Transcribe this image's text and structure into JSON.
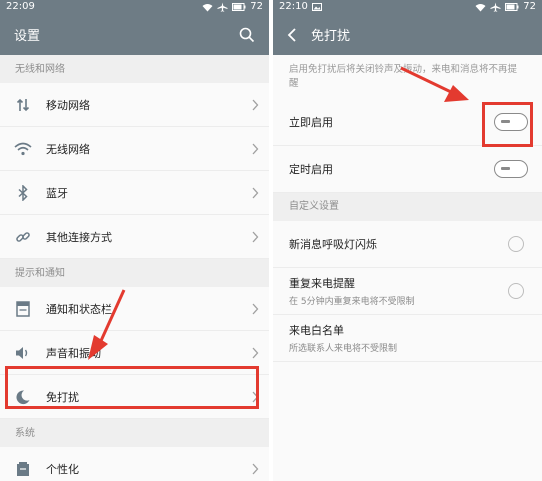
{
  "left_screen": {
    "status_bar": {
      "time": "22:09",
      "battery": "72"
    },
    "header": {
      "title": "设置"
    },
    "sections": [
      {
        "title": "无线和网络",
        "items": [
          {
            "label": "移动网络",
            "icon": "mobile-data-icon"
          },
          {
            "label": "无线网络",
            "icon": "wifi-icon"
          },
          {
            "label": "蓝牙",
            "icon": "bluetooth-icon"
          },
          {
            "label": "其他连接方式",
            "icon": "link-icon"
          }
        ]
      },
      {
        "title": "提示和通知",
        "items": [
          {
            "label": "通知和状态栏",
            "icon": "notification-icon"
          },
          {
            "label": "声音和振动",
            "icon": "sound-icon"
          },
          {
            "label": "免打扰",
            "icon": "moon-icon",
            "highlighted": true
          }
        ]
      },
      {
        "title": "系统",
        "items": [
          {
            "label": "个性化",
            "icon": "personalize-icon"
          }
        ]
      }
    ]
  },
  "right_screen": {
    "status_bar": {
      "time": "22:10",
      "battery": "72"
    },
    "header": {
      "title": "免打扰"
    },
    "description": "启用免打扰后将关闭铃声及振动，来电和消息将不再提醒",
    "toggles": [
      {
        "label": "立即启用",
        "on": false,
        "highlighted": true
      },
      {
        "label": "定时启用",
        "on": false
      }
    ],
    "custom_section_title": "自定义设置",
    "custom_items": [
      {
        "label": "新消息呼吸灯闪烁",
        "sub": "",
        "checked": false
      },
      {
        "label": "重复来电提醒",
        "sub": "在 5分钟内重复来电将不受限制",
        "checked": false
      },
      {
        "label": "来电白名单",
        "sub": "所选联系人来电将不受限制"
      }
    ]
  },
  "colors": {
    "header": "#6e7c85",
    "highlight": "#e33a2f"
  }
}
